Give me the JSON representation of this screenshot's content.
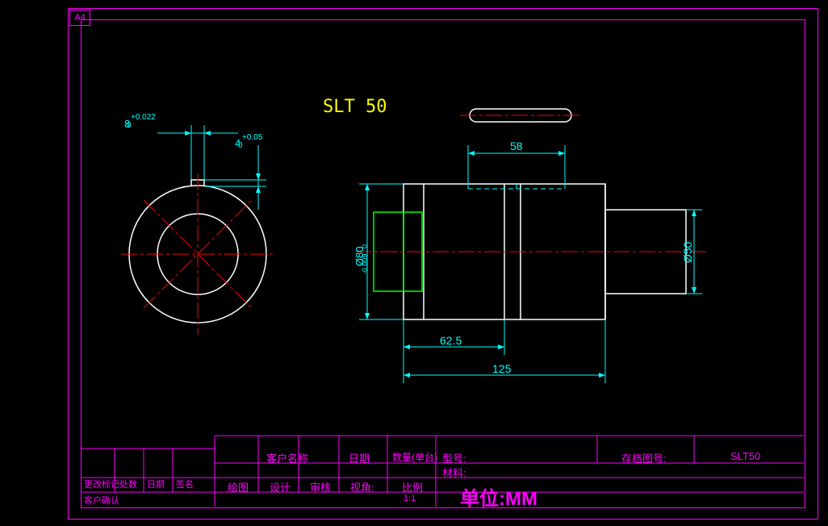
{
  "sheet": {
    "format": "A4"
  },
  "title": "SLT 50",
  "dimensions": {
    "width_tol": "8",
    "width_tol_upper": "+0.022",
    "width_tol_lower": "0",
    "depth_tol": "4",
    "depth_tol_upper": "+0.05",
    "depth_tol_lower": "0",
    "slot_width": "58",
    "diameter_main": "Ø80",
    "diameter_main_upper": "0",
    "diameter_main_lower": "-0.009",
    "diameter_shaft": "Ø50",
    "half_length": "62.5",
    "full_length": "125"
  },
  "titleblock": {
    "labels": {
      "customer": "客户名称",
      "date": "日期",
      "qty": "数量(单台)",
      "model": "型号:",
      "archive": "存档图号:",
      "material": "材料:",
      "draw": "绘图",
      "design": "设计",
      "check": "审核",
      "view": "视角:",
      "scale": "比例",
      "units": "单位:MM",
      "change_mark": "更改标记",
      "process": "处数",
      "date2": "日期",
      "sign": "签名",
      "customer_confirm": "客户确认"
    },
    "values": {
      "archive_no": "SLT50",
      "scale_val": "1:1"
    }
  }
}
